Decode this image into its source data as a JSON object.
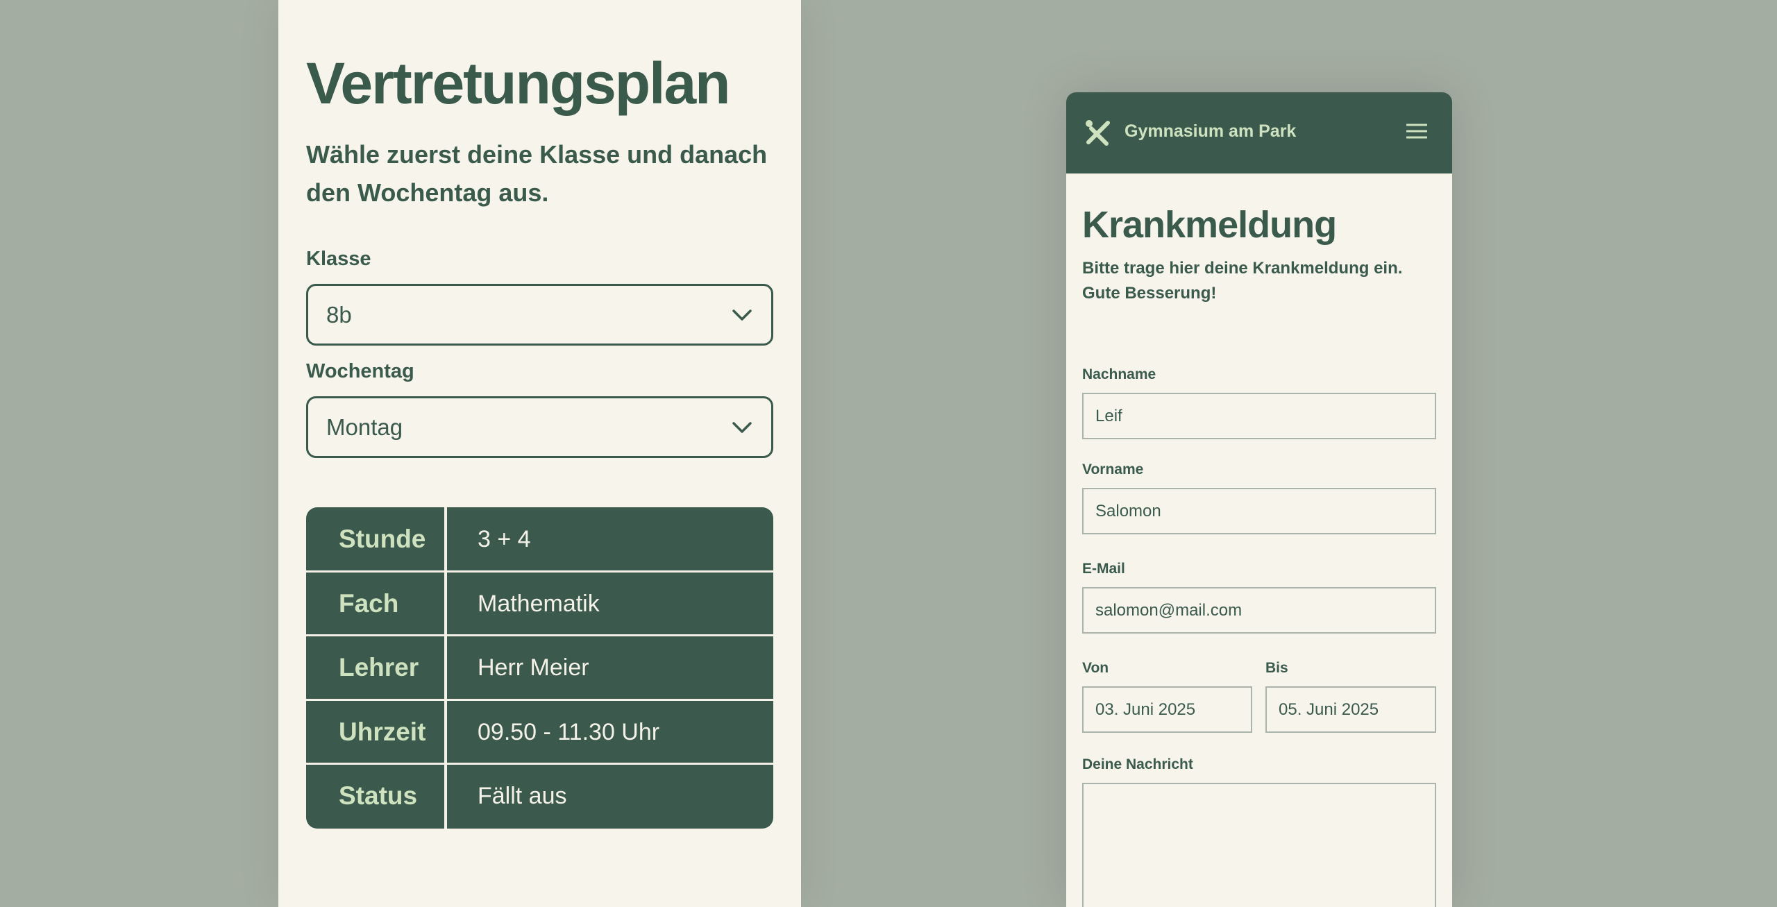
{
  "vertretungsplan": {
    "title": "Vertretungsplan",
    "subtitle": "Wähle zuerst deine Klasse und danach den Wochentag aus.",
    "klasse": {
      "label": "Klasse",
      "value": "8b"
    },
    "wochentag": {
      "label": "Wochentag",
      "value": "Montag"
    },
    "schedule": [
      {
        "key": "Stunde",
        "value": "3 + 4"
      },
      {
        "key": "Fach",
        "value": "Mathematik"
      },
      {
        "key": "Lehrer",
        "value": "Herr Meier"
      },
      {
        "key": "Uhrzeit",
        "value": "09.50 - 11.30 Uhr"
      },
      {
        "key": "Status",
        "value": "Fällt aus"
      }
    ]
  },
  "krankmeldung": {
    "school_name": "Gymnasium am Park",
    "title": "Krankmeldung",
    "subtitle": "Bitte trage hier deine Krankmeldung ein. Gute Besserung!",
    "nachname": {
      "label": "Nachname",
      "value": "Leif"
    },
    "vorname": {
      "label": "Vorname",
      "value": "Salomon"
    },
    "email": {
      "label": "E-Mail",
      "value": "salomon@mail.com"
    },
    "von": {
      "label": "Von",
      "value": "03. Juni 2025"
    },
    "bis": {
      "label": "Bis",
      "value": "05. Juni 2025"
    },
    "nachricht": {
      "label": "Deine Nachricht",
      "value": ""
    }
  },
  "colors": {
    "background": "#a4ada2",
    "panel": "#f7f4ec",
    "primary_green": "#3b5a4d",
    "accent_light_green": "#cfe2bf"
  },
  "icons": {
    "logo": "logo-icon",
    "menu": "hamburger-menu-icon",
    "select": "chevron-down-icon"
  }
}
